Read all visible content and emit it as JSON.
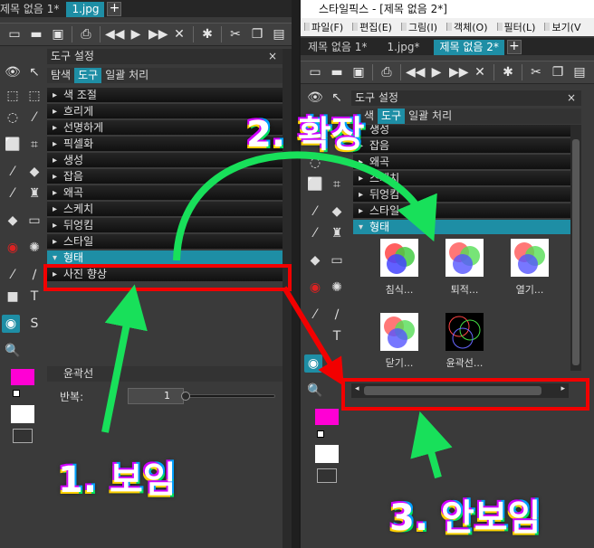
{
  "left": {
    "tabs": [
      {
        "label": "제목 없음 1*",
        "active": false
      },
      {
        "label": "1.jpg",
        "active": true
      }
    ],
    "panel_title": "도구 설정",
    "panel_close": "×",
    "subtabs": [
      "탐색",
      "도구",
      "일괄 처리"
    ],
    "categories": [
      "색 조절",
      "흐리게",
      "선명하게",
      "픽셀화",
      "생성",
      "잡음",
      "왜곡",
      "스케치",
      "뒤엉킴",
      "스타일",
      "형태",
      "사진 향상"
    ],
    "section_title": "윤곽선",
    "repeat_label": "반복:",
    "repeat_value": "1"
  },
  "right": {
    "window_title": "스타일픽스 - [제목 없음 2*]",
    "menu": [
      "파일(F)",
      "편집(E)",
      "그림(I)",
      "객체(O)",
      "필터(L)",
      "보기(V"
    ],
    "tabs": [
      {
        "label": "제목 없음 1*",
        "active": false
      },
      {
        "label": "1.jpg*",
        "active": false
      },
      {
        "label": "제목 없음 2*",
        "active": true
      }
    ],
    "panel_title": "도구 설정",
    "panel_close": "×",
    "subtabs": [
      "색",
      "도구",
      "일괄 처리"
    ],
    "categories": [
      "생성",
      "잡음",
      "왜곡",
      "스케치",
      "뒤엉킴",
      "스타일",
      "형태"
    ],
    "thumbnails": [
      "침식...",
      "퇴적...",
      "열기...",
      "닫기...",
      "윤곽선..."
    ]
  },
  "annotations": {
    "visible": "1. 보임",
    "expand": "2. 확장",
    "invisible": "3. 안보임"
  },
  "colors": {
    "accent": "#1e8ea5",
    "highlight_red": "#f20000",
    "arrow_green": "#18e05a",
    "swatch_fg": "#ff00d4",
    "swatch_bg": "#ffffff"
  }
}
